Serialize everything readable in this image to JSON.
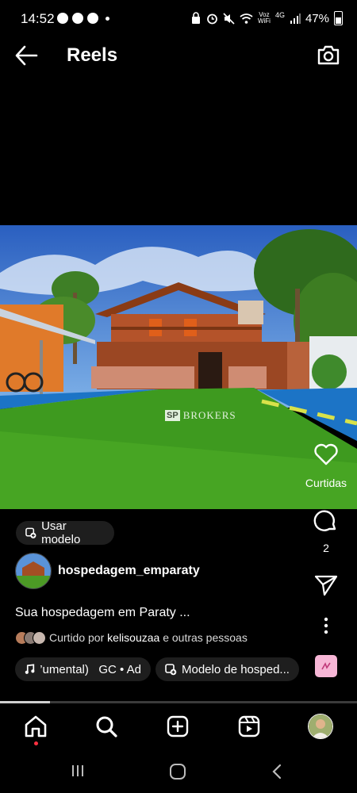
{
  "status_bar": {
    "time": "14:52",
    "voz": "Voz",
    "wifi": "WiFi",
    "network": "4G",
    "battery": "47%"
  },
  "header": {
    "title": "Reels",
    "back_icon": "arrow-left-icon",
    "camera_icon": "camera-icon"
  },
  "post": {
    "watermark": "BROKERS",
    "watermark_logo": "SP",
    "use_template_label": "Usar modelo",
    "username": "hospedagem_emparaty",
    "caption": "Sua hospedagem em Paraty ...",
    "liked_prefix": "Curtido por ",
    "liked_user": "kelisouzaa",
    "liked_suffix": " e outras pessoas",
    "audio_label": "’umental)   GC • Ad",
    "template_chip_label": "Modelo de hosped..."
  },
  "actions": {
    "like_label": "Curtidas",
    "comment_count": "2"
  },
  "progress": 0.14,
  "bottom_nav": [
    "home-icon",
    "search-icon",
    "create-icon",
    "reels-icon",
    "profile-avatar"
  ],
  "colors": {
    "background": "#000000",
    "chip": "#1e1e1e",
    "accent_pink": "#f7b6d6",
    "notification_red": "#ff3040"
  }
}
